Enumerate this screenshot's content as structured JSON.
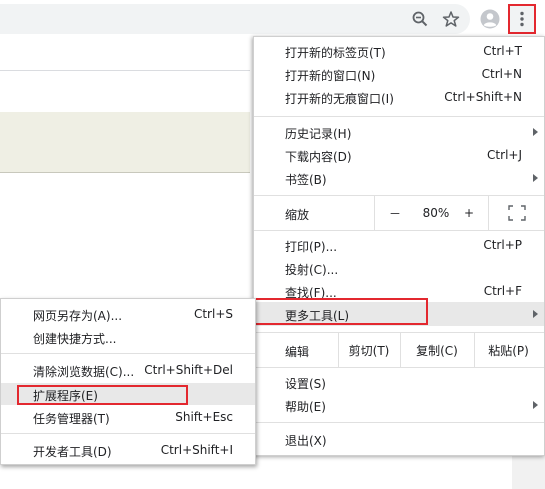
{
  "menu": {
    "items": [
      {
        "label": "打开新的标签页(T)",
        "shortcut": "Ctrl+T"
      },
      {
        "label": "打开新的窗口(N)",
        "shortcut": "Ctrl+N"
      },
      {
        "label": "打开新的无痕窗口(I)",
        "shortcut": "Ctrl+Shift+N"
      },
      {
        "label": "历史记录(H)",
        "shortcut": ""
      },
      {
        "label": "下载内容(D)",
        "shortcut": "Ctrl+J"
      },
      {
        "label": "书签(B)",
        "shortcut": ""
      },
      {
        "label": "打印(P)...",
        "shortcut": "Ctrl+P"
      },
      {
        "label": "投射(C)...",
        "shortcut": ""
      },
      {
        "label": "查找(F)...",
        "shortcut": "Ctrl+F"
      },
      {
        "label": "更多工具(L)",
        "shortcut": ""
      },
      {
        "label": "设置(S)",
        "shortcut": ""
      },
      {
        "label": "帮助(E)",
        "shortcut": ""
      },
      {
        "label": "退出(X)",
        "shortcut": ""
      }
    ],
    "zoom": {
      "label": "缩放",
      "minus": "－",
      "value": "80%",
      "plus": "+"
    },
    "edit": {
      "label": "编辑",
      "cut": "剪切(T)",
      "copy": "复制(C)",
      "paste": "粘贴(P)"
    }
  },
  "submenu": {
    "items": [
      {
        "label": "网页另存为(A)...",
        "shortcut": "Ctrl+S"
      },
      {
        "label": "创建快捷方式...",
        "shortcut": ""
      },
      {
        "label": "清除浏览数据(C)...",
        "shortcut": "Ctrl+Shift+Del"
      },
      {
        "label": "扩展程序(E)",
        "shortcut": ""
      },
      {
        "label": "任务管理器(T)",
        "shortcut": "Shift+Esc"
      },
      {
        "label": "开发者工具(D)",
        "shortcut": "Ctrl+Shift+I"
      }
    ]
  },
  "icons": {
    "zoom": "magnifier-minus-icon",
    "star": "bookmark-star-icon",
    "avatar": "profile-avatar-icon",
    "menu": "three-dot-menu-icon",
    "fullscreen": "fullscreen-icon"
  },
  "colors": {
    "highlight_box": "#e3282f",
    "hover_row": "#e8e8e8"
  }
}
